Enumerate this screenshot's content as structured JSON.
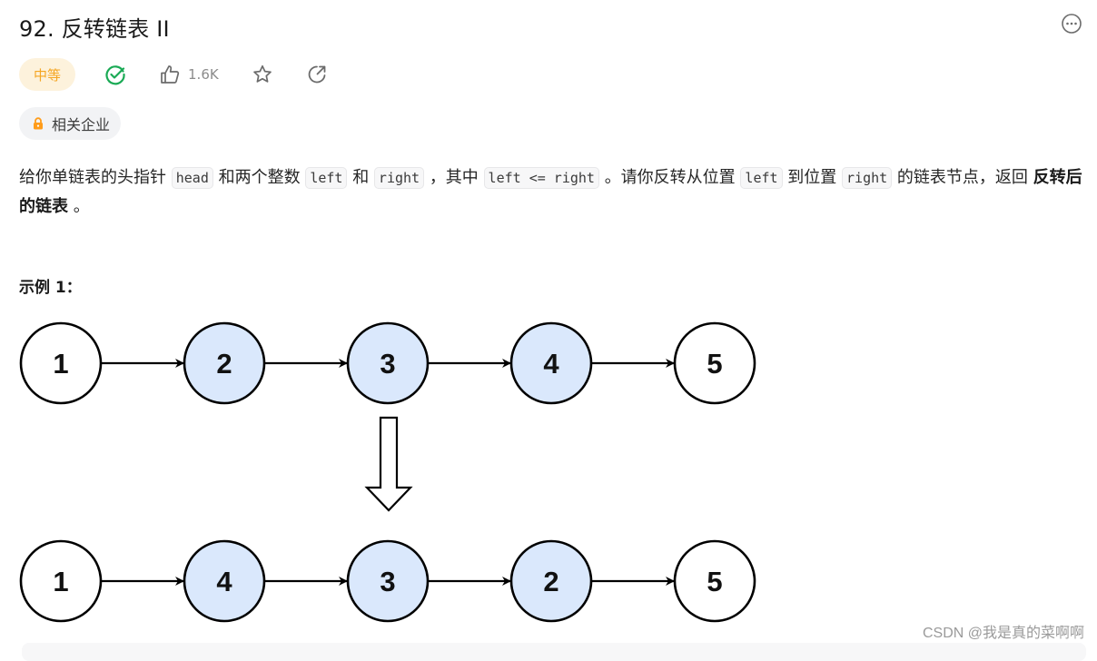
{
  "problem": {
    "title": "92. 反转链表 II",
    "difficulty": "中等",
    "solved": true,
    "likes": "1.6K",
    "company_tag": "相关企业"
  },
  "icons": {
    "more": "more-horizontal-circle-icon",
    "solved": "check-circle-icon",
    "like": "thumbs-up-icon",
    "favorite": "star-icon",
    "share": "share-icon",
    "lock": "lock-icon"
  },
  "colors": {
    "difficulty_text": "#f5a623",
    "difficulty_bg": "#fdf2dc",
    "solved_green": "#1aaa55",
    "lock_orange": "#ff9c1a",
    "node_highlight": "#dae8fc",
    "node_plain": "#ffffff"
  },
  "description": {
    "p1": "给你单链表的头指针",
    "code_head": "head",
    "p2": "和两个整数",
    "code_left": "left",
    "p3": "和",
    "code_right": "right",
    "p4": "，其中",
    "code_cond": "left <= right",
    "p5": "。请你反转从位置",
    "code_left2": "left",
    "p6": "到位置",
    "code_right2": "right",
    "p7": "的链表节点，返回",
    "bold": "反转后的链表",
    "p8": "。"
  },
  "example": {
    "title": "示例 1：",
    "before": [
      {
        "label": "1",
        "highlight": false
      },
      {
        "label": "2",
        "highlight": true
      },
      {
        "label": "3",
        "highlight": true
      },
      {
        "label": "4",
        "highlight": true
      },
      {
        "label": "5",
        "highlight": false
      }
    ],
    "after": [
      {
        "label": "1",
        "highlight": false
      },
      {
        "label": "4",
        "highlight": true
      },
      {
        "label": "3",
        "highlight": true
      },
      {
        "label": "2",
        "highlight": true
      },
      {
        "label": "5",
        "highlight": false
      }
    ]
  },
  "watermark": "CSDN @我是真的菜啊啊"
}
